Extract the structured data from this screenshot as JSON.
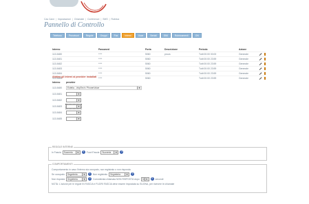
{
  "nav": {
    "home": "Cas Cane",
    "items": [
      "Impostazioni",
      "Chiamate",
      "Conferenze",
      "SMS",
      "Rubrica"
    ]
  },
  "page_title": "Pannello di Controllo",
  "tabs": [
    {
      "label": "Telefono",
      "active": false
    },
    {
      "label": "Provvisori",
      "active": false
    },
    {
      "label": "Regole",
      "active": false
    },
    {
      "label": "Gruppi",
      "active": false
    },
    {
      "label": "Fax",
      "active": false
    },
    {
      "label": "Interni",
      "active": true
    },
    {
      "label": "Voce",
      "active": false
    },
    {
      "label": "Seriali",
      "active": false
    },
    {
      "label": "SIM",
      "active": false
    },
    {
      "label": "Rubricamenti",
      "active": false
    },
    {
      "label": "ON",
      "active": false
    }
  ],
  "extensions": {
    "headers": [
      "Interno",
      "Password",
      "Porta",
      "Descrizione",
      "Periodo",
      "Azione"
    ],
    "rows": [
      {
        "interno": "113-5480",
        "password": "****",
        "porta": "5060",
        "descrizione": "prova",
        "periodo": "Tutti 00:00 00:00",
        "azione": "Generale"
      },
      {
        "interno": "113-5481",
        "password": "****",
        "porta": "5060",
        "descrizione": "",
        "periodo": "Tutti 00:00 23:59",
        "azione": "Generale"
      },
      {
        "interno": "113-5482",
        "password": "****",
        "porta": "5060",
        "descrizione": "",
        "periodo": "Tutti 00:00 23:59",
        "azione": "Generale"
      },
      {
        "interno": "113-5483",
        "password": "****",
        "porta": "5060",
        "descrizione": "",
        "periodo": "Tutti 00:00 23:59",
        "azione": "Generale"
      },
      {
        "interno": "113-5484",
        "password": "****",
        "porta": "5060",
        "descrizione": "",
        "periodo": "Tutti 00:00 23:59",
        "azione": "Generale"
      },
      {
        "interno": "113-5485",
        "password": "****",
        "porta": "5060",
        "descrizione": "",
        "periodo": "Tutti 00:00 23:59",
        "azione": "Generale"
      }
    ]
  },
  "providers": {
    "title": "Abbina gli interni ai provider installati",
    "headers": [
      "Interno",
      "provider"
    ],
    "rows": [
      {
        "interno": "113-5480",
        "value": "Eutelia - VoipTech / PhonerVoice"
      },
      {
        "interno": "113-5481",
        "value": ""
      },
      {
        "interno": "113-5482",
        "value": ""
      },
      {
        "interno": "113-5483",
        "value": ""
      },
      {
        "interno": "113-5484",
        "value": ""
      },
      {
        "interno": "113-5485",
        "value": ""
      }
    ]
  },
  "regole": {
    "legend": "REGOLE INTERNE",
    "in_fascia_label": "In Fascia",
    "in_fascia_value": "Suoneria",
    "fuori_fascia_label": "Fuori Fascia",
    "fuori_fascia_value": "Suoneria"
  },
  "comportamenti": {
    "legend": "COMPORTAMENTI",
    "line1": "Comportamento in caso l'interno sia occupato, non registrato o non risponda",
    "occupato_label": "Se occupato",
    "occupato_value": "Segreteria",
    "non_registrato_label": "Non registrato",
    "non_registrato_value": "Segreteria",
    "non_risposta_label": "Non risposta",
    "non_risposta_value": "Segreteria",
    "consegna_label": "Considerata chiamata NON RISPOSTA dopo",
    "consegna_value": "30",
    "secondi_label": "secondi",
    "nota": "NOTA: L'azione per le regole IN FASCIA e FUORI FASCIA deve essere impostata su SUONA, per ricevere le chiamate"
  },
  "colors": {
    "tab": "#8fb6d8",
    "tab_active": "#f0a232",
    "title": "#6b8aa6",
    "help_icon": "#3c63b0"
  }
}
